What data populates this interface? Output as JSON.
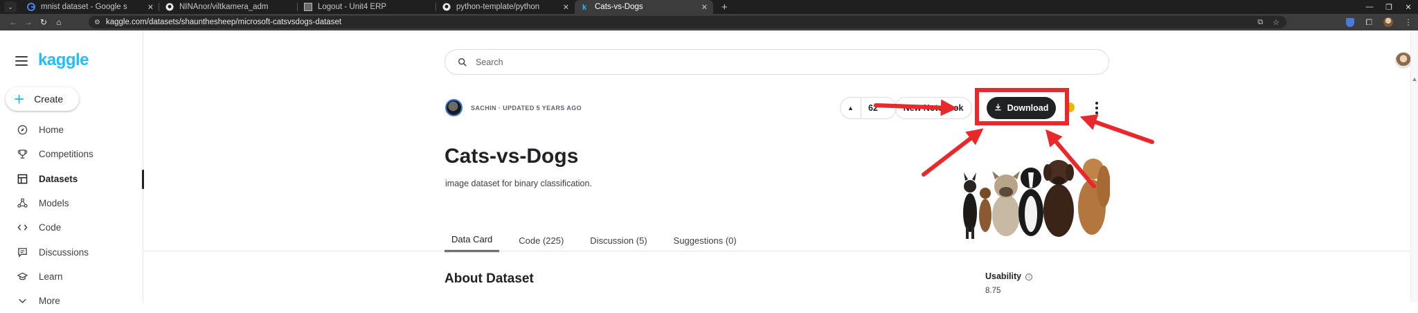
{
  "browser": {
    "tabs": [
      {
        "title": "mnist dataset - Google s",
        "favicon": "google-icon",
        "active": false
      },
      {
        "title": "NINAnor/viltkamera_adm",
        "favicon": "github-icon",
        "active": false
      },
      {
        "title": "Logout - Unit4 ERP",
        "favicon": "unit4-icon",
        "active": false
      },
      {
        "title": "python-template/python",
        "favicon": "github-icon",
        "active": false
      },
      {
        "title": "Cats-vs-Dogs",
        "favicon": "kaggle-icon",
        "active": true
      }
    ],
    "url": "kaggle.com/datasets/shaunthesheep/microsoft-catsvsdogs-dataset"
  },
  "kaggle": {
    "logo": "kaggle",
    "create_label": "Create",
    "nav": [
      {
        "label": "Home",
        "icon": "compass-icon"
      },
      {
        "label": "Competitions",
        "icon": "trophy-icon"
      },
      {
        "label": "Datasets",
        "icon": "table-icon",
        "active": true
      },
      {
        "label": "Models",
        "icon": "models-icon"
      },
      {
        "label": "Code",
        "icon": "code-icon"
      },
      {
        "label": "Discussions",
        "icon": "chat-icon"
      },
      {
        "label": "Learn",
        "icon": "graduation-cap-icon"
      },
      {
        "label": "More",
        "icon": "chevron-down-icon"
      }
    ],
    "search_placeholder": "Search"
  },
  "dataset": {
    "author_meta": "SACHIN · UPDATED 5 YEARS AGO",
    "vote_count": "62",
    "notebook_label": "New Notebook",
    "notebook_visible": "N    N    ook",
    "download_label": "Download",
    "title": "Cats-vs-Dogs",
    "subtitle": "image dataset for binary classification.",
    "tabs": [
      {
        "label": "Data Card",
        "active": true
      },
      {
        "label": "Code (225)"
      },
      {
        "label": "Discussion (5)"
      },
      {
        "label": "Suggestions (0)"
      }
    ],
    "about_heading": "About Dataset",
    "usability_label": "Usability",
    "usability_value": "8.75"
  },
  "annotation": {
    "color": "#e8282b"
  }
}
